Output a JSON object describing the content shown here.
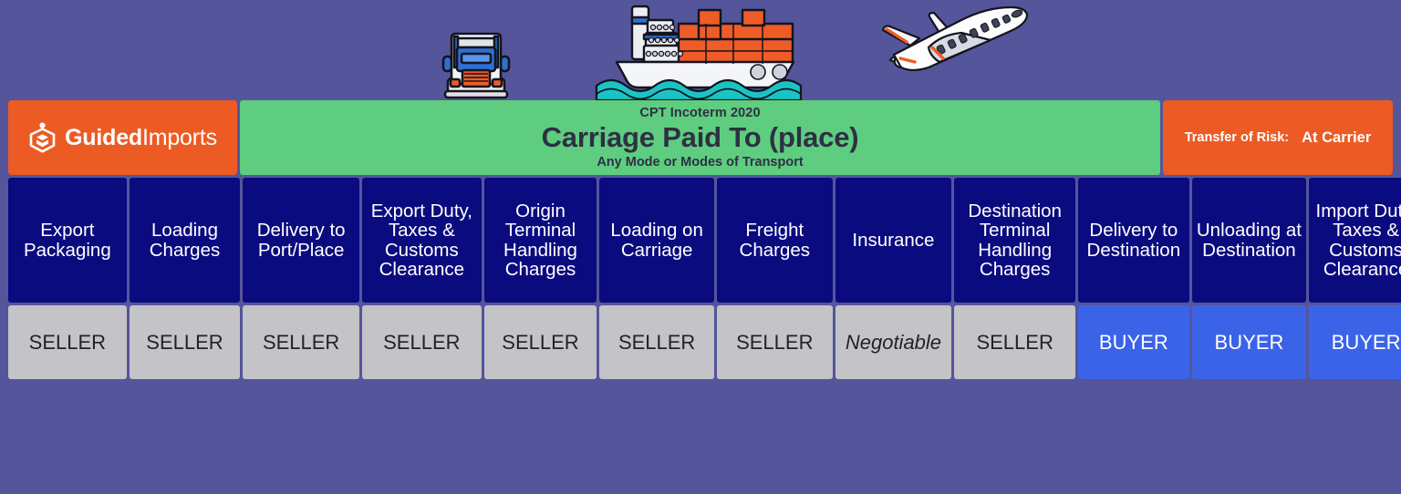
{
  "brand": {
    "bold_word": "Guided",
    "light_word": "Imports",
    "logo_icon": "guided-imports-hexagon-logo",
    "background_color": "#ec5b24"
  },
  "transport_icons": [
    {
      "name": "truck-icon",
      "label": "Truck"
    },
    {
      "name": "container-ship-icon",
      "label": "Container Ship"
    },
    {
      "name": "airplane-icon",
      "label": "Airplane"
    }
  ],
  "title": {
    "eyebrow": "CPT Incoterm 2020",
    "heading": "Carriage Paid To (place)",
    "subtitle": "Any Mode or Modes of Transport",
    "background_color": "#5ecd80"
  },
  "risk": {
    "label": "Transfer of Risk:",
    "value": "At Carrier",
    "background_color": "#ec5b24"
  },
  "table": {
    "header_color": "#0b0b80",
    "seller_color": "#c3c3c8",
    "buyer_color": "#3b63e8",
    "columns": [
      {
        "header": "Export Packaging",
        "value": "SELLER",
        "party": "seller"
      },
      {
        "header": "Loading Charges",
        "value": "SELLER",
        "party": "seller"
      },
      {
        "header": "Delivery to Port/Place",
        "value": "SELLER",
        "party": "seller"
      },
      {
        "header": "Export Duty, Taxes & Customs Clearance",
        "value": "SELLER",
        "party": "seller"
      },
      {
        "header": "Origin Terminal Handling Charges",
        "value": "SELLER",
        "party": "seller"
      },
      {
        "header": "Loading on Carriage",
        "value": "SELLER",
        "party": "seller"
      },
      {
        "header": "Freight Charges",
        "value": "SELLER",
        "party": "seller"
      },
      {
        "header": "Insurance",
        "value": "Negotiable",
        "party": "negotiable"
      },
      {
        "header": "Destination Terminal Handling Charges",
        "value": "SELLER",
        "party": "seller"
      },
      {
        "header": "Delivery to Destination",
        "value": "BUYER",
        "party": "buyer"
      },
      {
        "header": "Unloading at Destination",
        "value": "BUYER",
        "party": "buyer"
      },
      {
        "header": "Import Duty, Taxes & Customs Clearance",
        "value": "BUYER",
        "party": "buyer"
      }
    ]
  },
  "page": {
    "background_color": "#55559b"
  }
}
